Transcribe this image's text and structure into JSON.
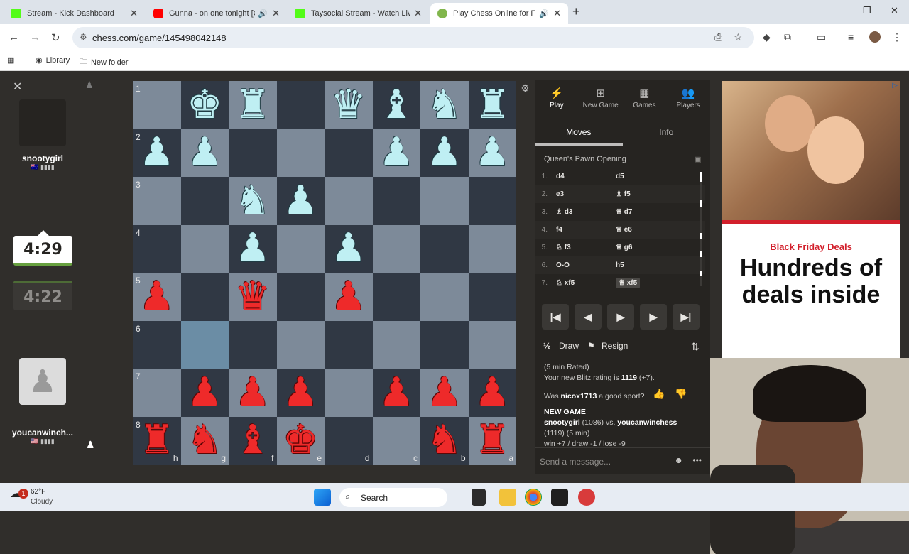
{
  "browser": {
    "tabs": [
      {
        "title": "Stream - Kick Dashboard",
        "icon": "kick-icon",
        "color": "#53fc18"
      },
      {
        "title": "Gunna - on one tonight [Of",
        "icon": "youtube-icon",
        "color": "#ff0000"
      },
      {
        "title": "Taysocial Stream - Watch Live o",
        "icon": "kick-icon",
        "color": "#53fc18"
      },
      {
        "title": "Play Chess Online for FREE",
        "icon": "chess-pawn-icon",
        "color": "#81b64c"
      }
    ],
    "url": "chess.com/game/145498042148",
    "bookmarks": [
      {
        "label": "Library",
        "icon": "library-icon"
      },
      {
        "label": "New folder",
        "icon": "folder-icon"
      }
    ]
  },
  "players": {
    "top": {
      "name": "snootygirl",
      "flag": "🇦🇺 ▮▮▮▮",
      "clock": "4:29"
    },
    "bottom": {
      "name": "youcanwinch...",
      "flag": "🇺🇸 ▮▮▮▮",
      "clock": "4:22"
    }
  },
  "board": {
    "ranks": [
      "1",
      "2",
      "3",
      "4",
      "5",
      "6",
      "7",
      "8"
    ],
    "files": [
      "h",
      "g",
      "f",
      "e",
      "d",
      "c",
      "b",
      "a"
    ],
    "rows": [
      [
        "",
        "wK",
        "wR",
        "",
        "wQ",
        "wB",
        "wN",
        "wR"
      ],
      [
        "wP",
        "wP",
        "",
        "",
        "",
        "wP",
        "wP",
        "wP"
      ],
      [
        "",
        "",
        "wN",
        "wP",
        "",
        "",
        "",
        ""
      ],
      [
        "",
        "",
        "wP",
        "",
        "wP",
        "",
        "",
        ""
      ],
      [
        "rP",
        "",
        "rQ",
        "",
        "rP",
        "",
        "",
        ""
      ],
      [
        "",
        "",
        "",
        "",
        "",
        "",
        "",
        ""
      ],
      [
        "",
        "rP",
        "rP",
        "rP",
        "",
        "rP",
        "rP",
        "rP"
      ],
      [
        "rR",
        "rN",
        "rB",
        "rK",
        "",
        "",
        "rN",
        "rR"
      ]
    ],
    "highlight": [
      [
        5,
        1
      ]
    ],
    "glyphs": {
      "K": "♚",
      "Q": "♛",
      "R": "♜",
      "B": "♝",
      "N": "♞",
      "P": "♟"
    }
  },
  "panel": {
    "tabs": [
      {
        "label": "Play",
        "icon": "bolt-icon",
        "glyph": "⚡"
      },
      {
        "label": "New Game",
        "icon": "plus-icon",
        "glyph": "⊞"
      },
      {
        "label": "Games",
        "icon": "board-icon",
        "glyph": "▦"
      },
      {
        "label": "Players",
        "icon": "players-icon",
        "glyph": "👥"
      }
    ],
    "subtabs": [
      "Moves",
      "Info"
    ],
    "opening": "Queen's Pawn Opening",
    "moves": [
      {
        "n": "1.",
        "w": "d4",
        "b": "d5"
      },
      {
        "n": "2.",
        "w": "e3",
        "b": "♗ f5"
      },
      {
        "n": "3.",
        "w": "♗ d3",
        "b": "♕ d7"
      },
      {
        "n": "4.",
        "w": "f4",
        "b": "♕ e6"
      },
      {
        "n": "5.",
        "w": "♘ f3",
        "b": "♕ g6"
      },
      {
        "n": "6.",
        "w": "O-O",
        "b": "h5"
      },
      {
        "n": "7.",
        "w": "♘ xf5",
        "b": "♕ xf5"
      }
    ],
    "controls": [
      "|◀",
      "◀",
      "▶",
      "▶",
      "▶|"
    ],
    "draw": "Draw",
    "draw_mark": "½",
    "resign": "Resign",
    "info_line1": "(5 min Rated)",
    "info_line2a": "Your new Blitz rating is ",
    "info_rating": "1119",
    "info_line2b": " (+7).",
    "sport_q_a": "Was ",
    "sport_name": "nicox1713",
    "sport_q_b": " a good sport?",
    "newgame_title": "NEW GAME",
    "newgame_p1": "snootygirl",
    "newgame_p1_rating": " (1086) vs. ",
    "newgame_p2": "youcanwinchess",
    "newgame_line2": "(1119) (5 min)",
    "newgame_line3": "win +7 / draw -1 / lose -9",
    "message_placeholder": "Send a message..."
  },
  "ad": {
    "sale": "Black Friday Deals",
    "headline": "Hundreds of deals inside"
  },
  "taskbar": {
    "weather_temp": "62°F",
    "weather_desc": "Cloudy",
    "badge": "1",
    "search": "Search"
  }
}
